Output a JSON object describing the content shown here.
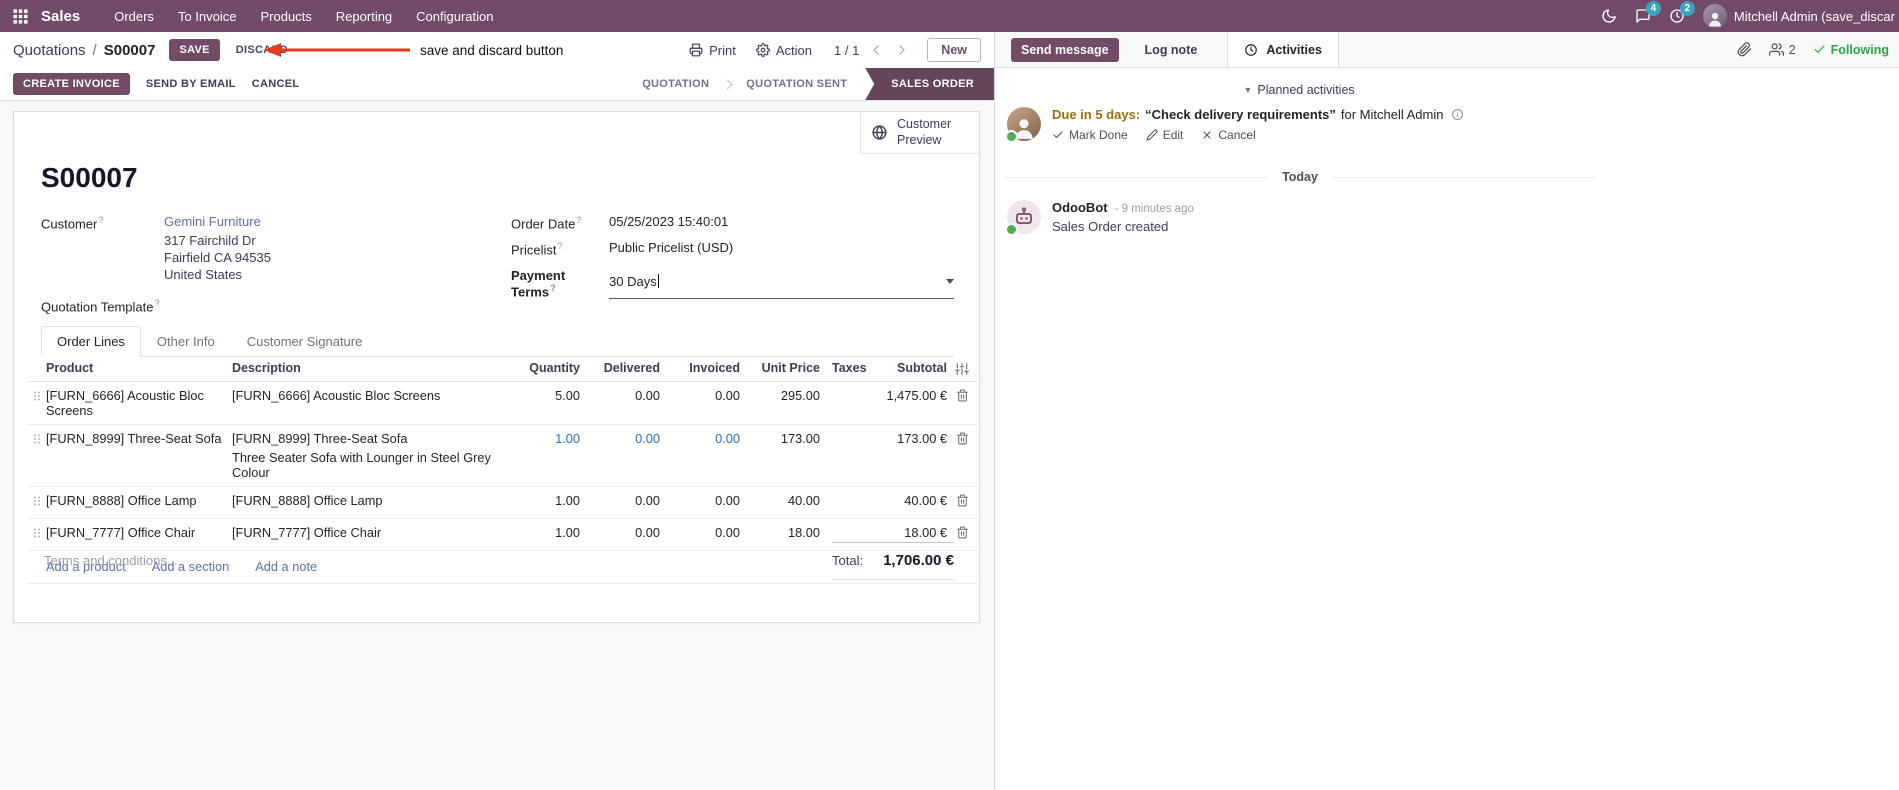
{
  "colors": {
    "brand_primary": "#714B67",
    "statusbar_active": "#63465B",
    "link": "#5C70AD",
    "modified_value": "#2472CC",
    "notification_badge": "#38A7BD",
    "following_green": "#28A745",
    "activity_due_future": "#9C6F0E",
    "annotation_red": "#E5391E"
  },
  "icons": {
    "apps": "grid",
    "dark_mode": "moon",
    "messages": "chat-bubble",
    "activities": "clock",
    "print": "printer",
    "action": "gear",
    "pager": "chevrons",
    "customer_preview": "globe",
    "attachments": "paperclip",
    "followers": "users",
    "following": "check",
    "row_drag": "dots-handle",
    "row_delete": "trash",
    "optional_columns": "sliders",
    "activity_info": "info-circle",
    "dropdown": "caret-down"
  },
  "topbar": {
    "app_name": "Sales",
    "menus": [
      "Orders",
      "To Invoice",
      "Products",
      "Reporting",
      "Configuration"
    ],
    "messages_badge": "4",
    "activities_badge": "2",
    "user_name": "Mitchell Admin (save_discar"
  },
  "control_panel": {
    "breadcrumb_parent": "Quotations",
    "breadcrumb_separator": "/",
    "breadcrumb_current": "S00007",
    "save_label": "SAVE",
    "discard_label": "DISCARD",
    "annotation": "save and discard button",
    "print_label": "Print",
    "action_label": "Action",
    "pager": "1 / 1",
    "new_label": "New"
  },
  "statusbar": {
    "action_buttons": [
      "CREATE INVOICE",
      "SEND BY EMAIL",
      "CANCEL"
    ],
    "states": [
      "QUOTATION",
      "QUOTATION SENT",
      "SALES ORDER"
    ],
    "active_state": "SALES ORDER"
  },
  "sheet": {
    "customer_preview_label": "Customer Preview",
    "record_name": "S00007",
    "hint_marker": "?",
    "fields": {
      "customer_label": "Customer",
      "customer_name": "Gemini Furniture",
      "address_line1": "317 Fairchild Dr",
      "address_line2": "Fairfield CA 94535",
      "address_line3": "United States",
      "quotation_template_label": "Quotation Template",
      "order_date_label": "Order Date",
      "order_date_value": "05/25/2023 15:40:01",
      "pricelist_label": "Pricelist",
      "pricelist_value": "Public Pricelist (USD)",
      "payment_terms_label": "Payment Terms",
      "payment_terms_value": "30 Days"
    },
    "tabs": [
      "Order Lines",
      "Other Info",
      "Customer Signature"
    ],
    "order_lines": {
      "headers": [
        "Product",
        "Description",
        "Quantity",
        "Delivered",
        "Invoiced",
        "Unit Price",
        "Taxes",
        "Subtotal"
      ],
      "rows": [
        {
          "product": "[FURN_6666] Acoustic Bloc Screens",
          "description": "[FURN_6666] Acoustic Bloc Screens",
          "description_extra": "",
          "quantity": "5.00",
          "delivered": "0.00",
          "invoiced": "0.00",
          "unit_price": "295.00",
          "taxes": "",
          "subtotal": "1,475.00 €"
        },
        {
          "product": "[FURN_8999] Three-Seat Sofa",
          "description": "[FURN_8999] Three-Seat Sofa",
          "description_extra": "Three Seater Sofa with Lounger in Steel Grey Colour",
          "quantity": "1.00",
          "delivered": "0.00",
          "invoiced": "0.00",
          "unit_price": "173.00",
          "taxes": "",
          "subtotal": "173.00 €"
        },
        {
          "product": "[FURN_8888] Office Lamp",
          "description": "[FURN_8888] Office Lamp",
          "description_extra": "",
          "quantity": "1.00",
          "delivered": "0.00",
          "invoiced": "0.00",
          "unit_price": "40.00",
          "taxes": "",
          "subtotal": "40.00 €"
        },
        {
          "product": "[FURN_7777] Office Chair",
          "description": "[FURN_7777] Office Chair",
          "description_extra": "",
          "quantity": "1.00",
          "delivered": "0.00",
          "invoiced": "0.00",
          "unit_price": "18.00",
          "taxes": "",
          "subtotal": "18.00 €"
        }
      ],
      "footer_links": [
        "Add a product",
        "Add a section",
        "Add a note"
      ]
    },
    "terms_placeholder": "Terms and conditions...",
    "total_label": "Total:",
    "total_value": "1,706.00 €"
  },
  "chatter": {
    "send_message_label": "Send message",
    "log_note_label": "Log note",
    "activities_label": "Activities",
    "followers_count": "2",
    "following_label": "Following",
    "planned_activities_header": "Planned activities",
    "activity": {
      "due_text": "Due in 5 days:",
      "summary": "“Check delivery requirements”",
      "assigned_to": "for Mitchell Admin",
      "mark_done_label": "Mark Done",
      "edit_label": "Edit",
      "cancel_label": "Cancel"
    },
    "date_divider": "Today",
    "messages": [
      {
        "author": "OdooBot",
        "timestamp": "- 9 minutes ago",
        "body": "Sales Order created"
      }
    ]
  }
}
